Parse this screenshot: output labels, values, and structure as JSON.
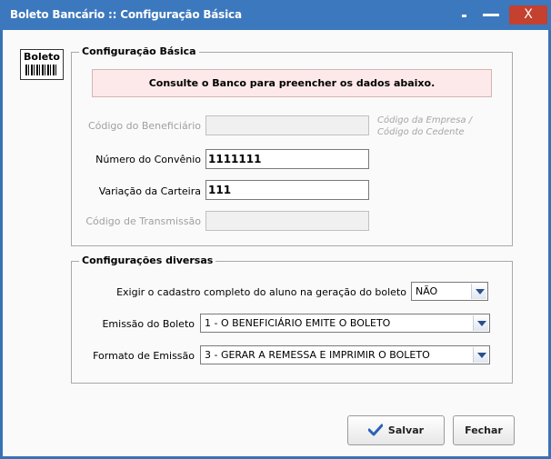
{
  "window": {
    "title": "Boleto Bancário :: Configuração Básica",
    "close_label": "X"
  },
  "logo": {
    "text": "Boleto"
  },
  "basic_config": {
    "legend": "Configuração Básica",
    "notice": "Consulte o Banco para preencher os dados abaixo.",
    "codigo_beneficiario": {
      "label": "Código do Beneficiário",
      "value": ""
    },
    "hint": {
      "line1": "Código da Empresa /",
      "line2": "Código do Cedente"
    },
    "numero_convenio": {
      "label": "Número do Convênio",
      "value": "1111111"
    },
    "variacao_carteira": {
      "label": "Variação da Carteira",
      "value": "111"
    },
    "codigo_transmissao": {
      "label": "Código de Transmissão",
      "value": ""
    }
  },
  "misc_config": {
    "legend": "Configurações diversas",
    "exigir_cadastro": {
      "label": "Exigir o cadastro completo do aluno na geração do boleto",
      "value": "NÃO"
    },
    "emissao_boleto": {
      "label": "Emissão do Boleto",
      "value": "1 - O BENEFICIÁRIO EMITE O BOLETO"
    },
    "formato_emissao": {
      "label": "Formato de Emissão",
      "value": "3 - GERAR A REMESSA E IMPRIMIR O BOLETO"
    }
  },
  "buttons": {
    "save": "Salvar",
    "close": "Fechar"
  },
  "colors": {
    "titlebar": "#3c78bd",
    "close_button": "#c4402f",
    "notice_background": "#fde9e9",
    "check_icon": "#2a62b5"
  }
}
